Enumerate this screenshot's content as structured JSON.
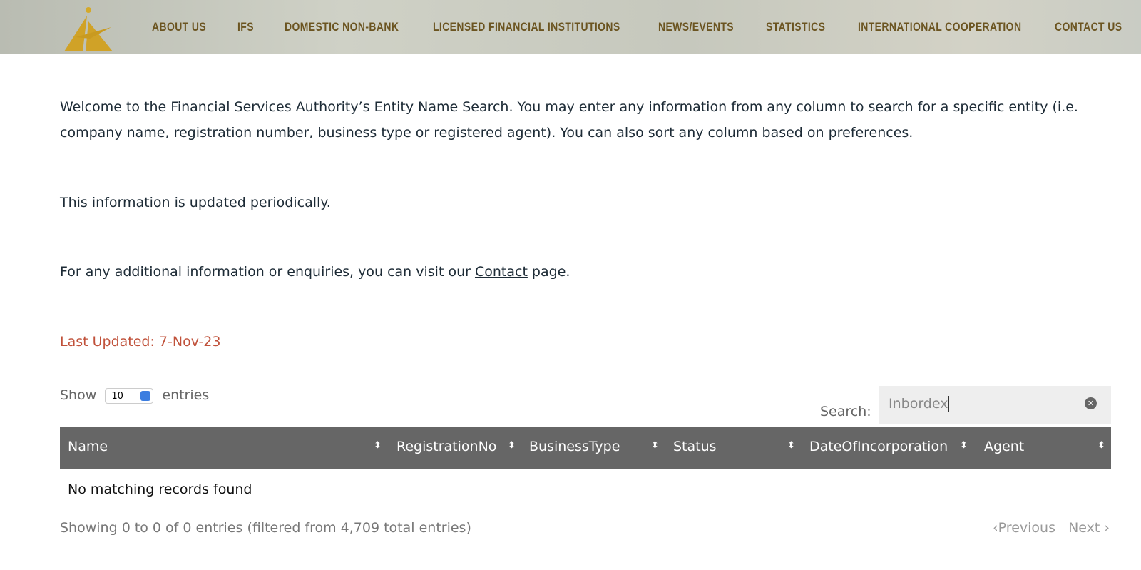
{
  "nav": {
    "items": [
      "ABOUT US",
      "IFS",
      "DOMESTIC NON-BANK",
      "LICENSED FINANCIAL INSTITUTIONS",
      "NEWS/EVENTS",
      "STATISTICS",
      "INTERNATIONAL COOPERATION",
      "CONTACT US"
    ]
  },
  "intro": {
    "p1": "Welcome to the Financial Services Authority’s Entity Name Search. You may enter any information from any column to search for a specific entity (i.e. company name, registration number, business type or registered agent). You can also sort any column based on preferences.",
    "p2": "This information is updated periodically.",
    "p3_before": "For any additional information or enquiries, you can visit our ",
    "p3_link": "Contact",
    "p3_after": " page.",
    "last_updated": "Last Updated:  7-Nov-23"
  },
  "table": {
    "show_label": "Show",
    "entries_value": "10",
    "entries_label": "entries",
    "search_label": "Search:",
    "search_value": "Inbordex",
    "columns": [
      "Name",
      "RegistrationNo",
      "BusinessType",
      "Status",
      "DateOfIncorporation",
      "Agent"
    ],
    "empty": "No matching records found",
    "info": "Showing 0 to 0 of 0 entries (filtered from 4,709 total entries)",
    "prev": "Previous",
    "next": "Next"
  }
}
